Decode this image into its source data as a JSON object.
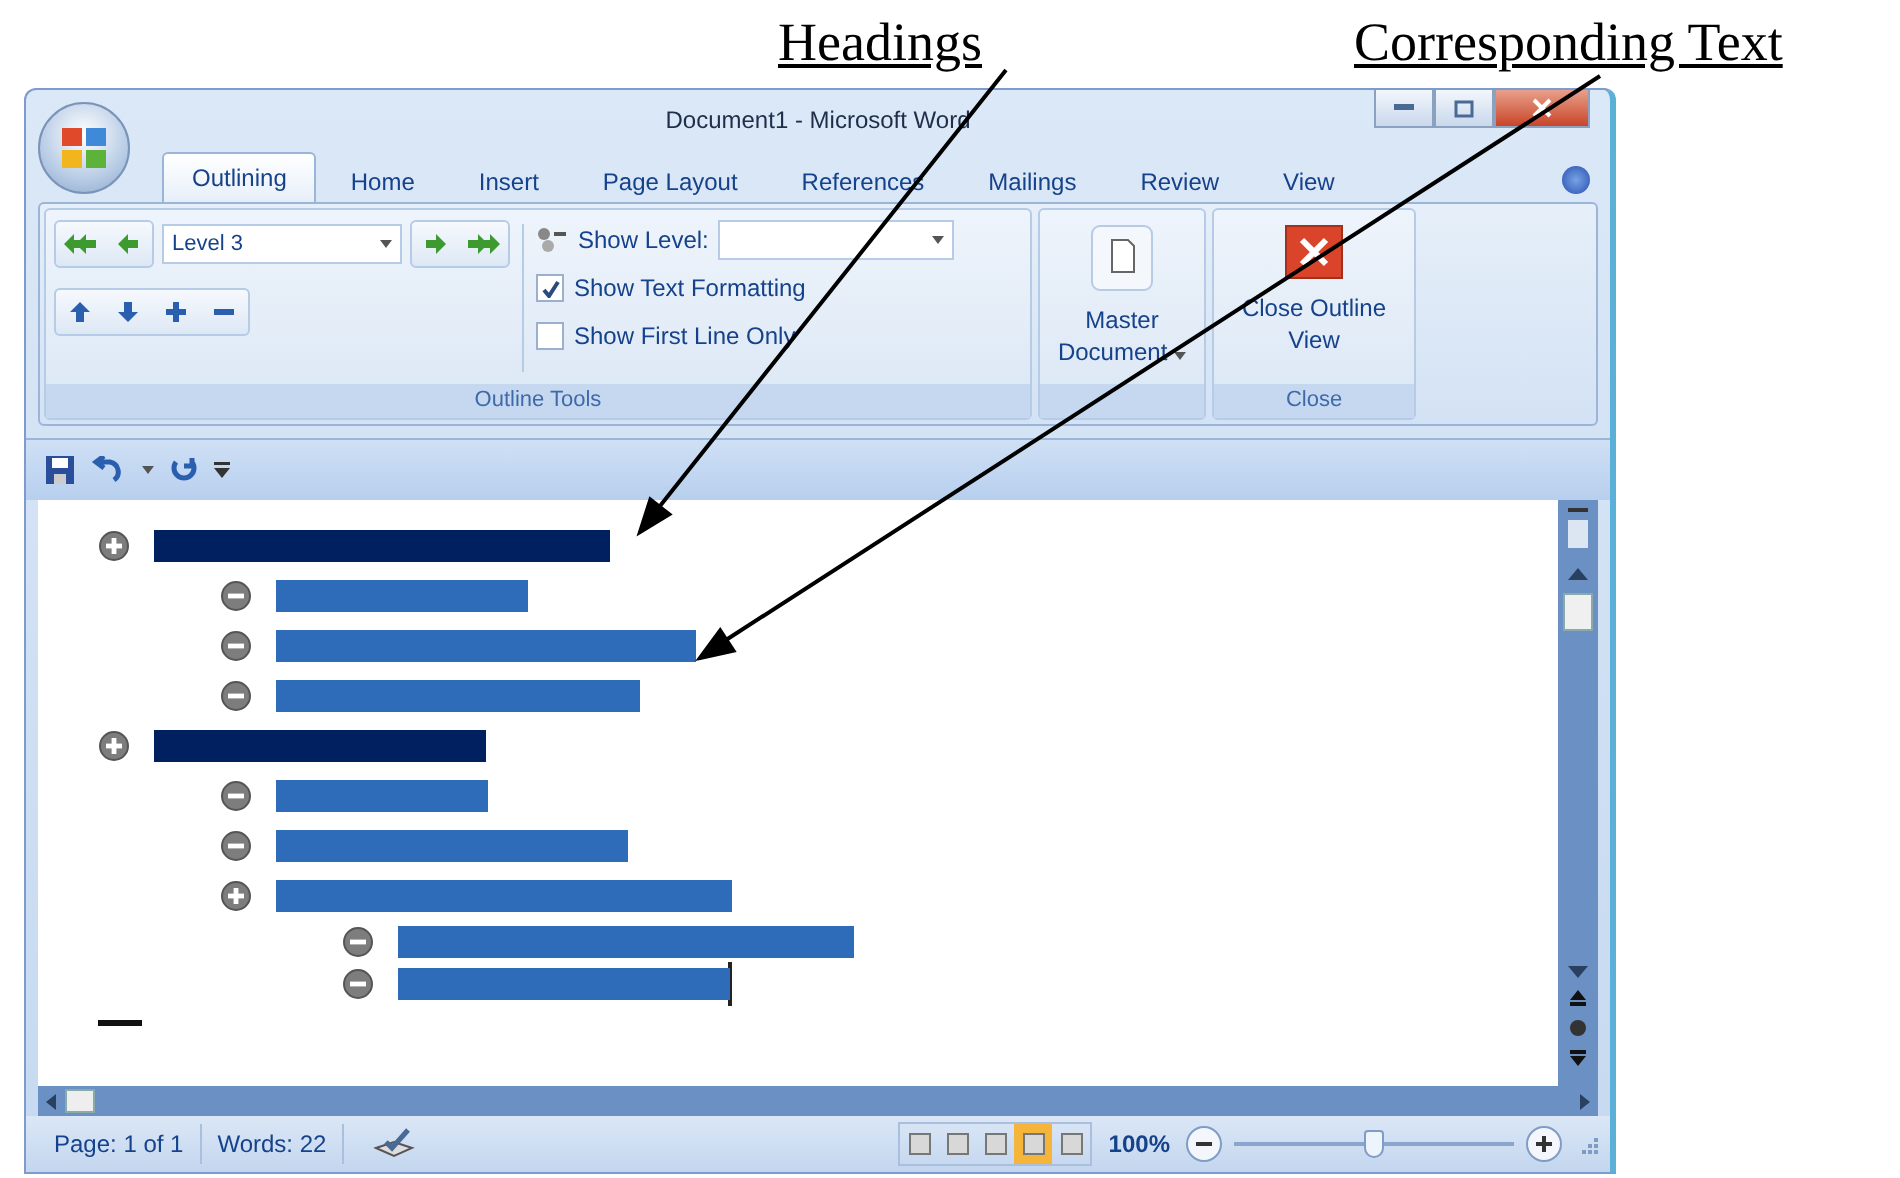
{
  "annotations": [
    {
      "label": "Headings"
    },
    {
      "label": "Corresponding Text"
    }
  ],
  "window": {
    "title": "Document1 - Microsoft Word"
  },
  "tabs": [
    {
      "label": "Outlining",
      "selected": true
    },
    {
      "label": "Home",
      "selected": false
    },
    {
      "label": "Insert",
      "selected": false
    },
    {
      "label": "Page Layout",
      "selected": false
    },
    {
      "label": "References",
      "selected": false
    },
    {
      "label": "Mailings",
      "selected": false
    },
    {
      "label": "Review",
      "selected": false
    },
    {
      "label": "View",
      "selected": false
    }
  ],
  "ribbon": {
    "level_dropdown": {
      "value": "Level 3"
    },
    "show_level": {
      "label": "Show Level:"
    },
    "options": [
      {
        "label": "Show Text Formatting",
        "checked": true
      },
      {
        "label": "Show First Line Only",
        "checked": false
      }
    ],
    "outline_group_label": "Outline Tools",
    "master_document": {
      "label": "Master Document"
    },
    "close_outline": {
      "label": "Close Outline View"
    },
    "close_group_label": "Close"
  },
  "outline": [
    {
      "kind": "plus",
      "children": [
        {
          "kind": "minus"
        },
        {
          "kind": "minus"
        },
        {
          "kind": "minus"
        }
      ]
    },
    {
      "kind": "plus",
      "children": [
        {
          "kind": "minus"
        },
        {
          "kind": "minus"
        },
        {
          "kind": "plus",
          "children": [
            {
              "kind": "minus"
            },
            {
              "kind": "minus"
            }
          ]
        }
      ]
    }
  ],
  "status_bar": {
    "page": "Page: 1 of 1",
    "words": "Words: 22",
    "views": [
      {
        "selected": false
      },
      {
        "selected": false
      },
      {
        "selected": false
      },
      {
        "selected": true
      },
      {
        "selected": false
      }
    ],
    "zoom": "100%",
    "zoom_slider": {
      "level": 0.5
    }
  }
}
